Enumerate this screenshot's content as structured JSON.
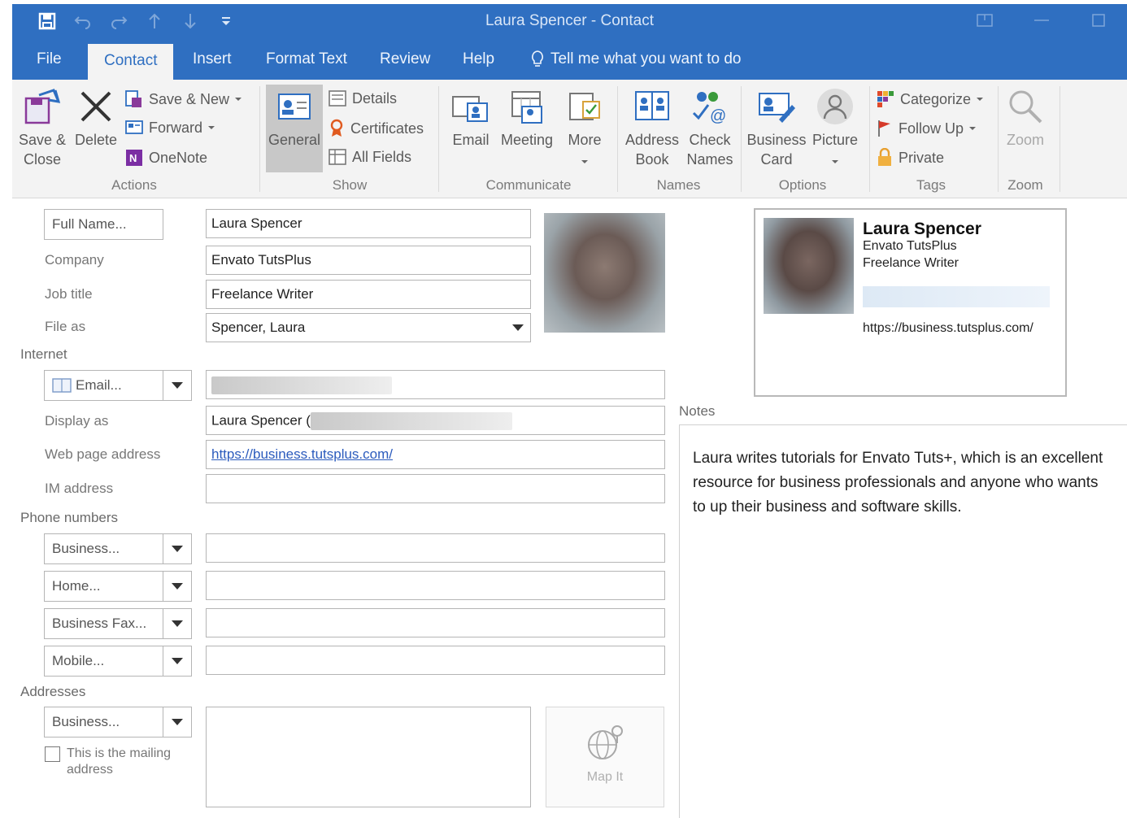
{
  "window": {
    "title": "Laura Spencer  -  Contact"
  },
  "tabs": [
    {
      "label": "File"
    },
    {
      "label": "Contact"
    },
    {
      "label": "Insert"
    },
    {
      "label": "Format Text"
    },
    {
      "label": "Review"
    },
    {
      "label": "Help"
    },
    {
      "label": "Tell me what you want to do"
    }
  ],
  "ribbon": {
    "actions": {
      "save_close": [
        "Save &",
        "Close"
      ],
      "delete": "Delete",
      "save_new": "Save & New",
      "forward": "Forward",
      "onenote": "OneNote",
      "group": "Actions"
    },
    "show": {
      "general": "General",
      "details": "Details",
      "certificates": "Certificates",
      "all_fields": "All Fields",
      "group": "Show"
    },
    "communicate": {
      "email": "Email",
      "meeting": "Meeting",
      "more": "More",
      "group": "Communicate"
    },
    "names": {
      "address_book": [
        "Address",
        "Book"
      ],
      "check_names": [
        "Check",
        "Names"
      ],
      "group": "Names"
    },
    "options": {
      "business_card": [
        "Business",
        "Card"
      ],
      "picture": "Picture",
      "group": "Options"
    },
    "tags": {
      "categorize": "Categorize",
      "follow_up": "Follow Up",
      "private": "Private",
      "group": "Tags"
    },
    "zoom": {
      "zoom": "Zoom",
      "group": "Zoom"
    }
  },
  "form": {
    "full_name_btn": "Full Name...",
    "full_name": "Laura Spencer",
    "company_label": "Company",
    "company": "Envato TutsPlus",
    "job_title_label": "Job title",
    "job_title": "Freelance Writer",
    "file_as_label": "File as",
    "file_as": "Spencer, Laura",
    "internet_section": "Internet",
    "email_btn": "Email...",
    "display_as_label": "Display as",
    "display_as": "Laura Spencer (",
    "web_label": "Web page address",
    "web": "https://business.tutsplus.com/",
    "im_label": "IM address",
    "phone_section": "Phone numbers",
    "phones": [
      {
        "label": "Business..."
      },
      {
        "label": "Home..."
      },
      {
        "label": "Business Fax..."
      },
      {
        "label": "Mobile..."
      }
    ],
    "addresses_section": "Addresses",
    "address_btn": "Business...",
    "mailing": [
      "This is the mailing",
      "address"
    ],
    "map_it": "Map It"
  },
  "card": {
    "name": "Laura Spencer",
    "company": "Envato TutsPlus",
    "title": "Freelance Writer",
    "url": "https://business.tutsplus.com/"
  },
  "notes": {
    "label": "Notes",
    "text": "Laura writes tutorials for Envato Tuts+, which is an excellent resource for business professionals and anyone who wants to up their business and software skills."
  }
}
